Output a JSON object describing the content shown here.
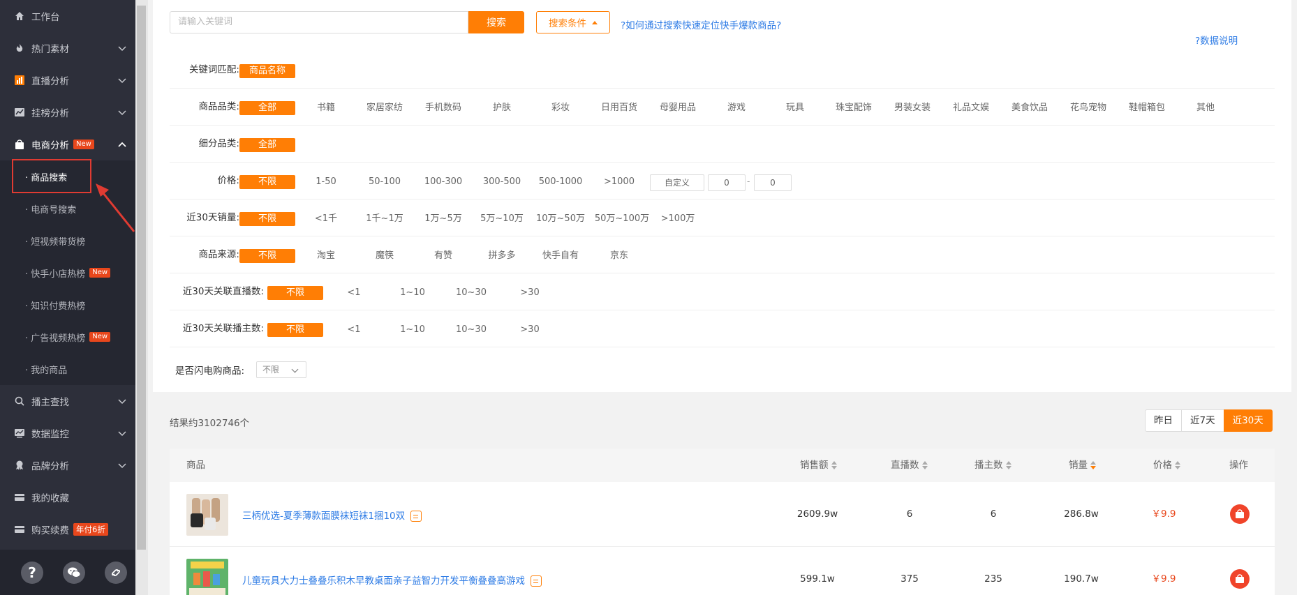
{
  "sidebar": {
    "items": [
      {
        "label": "工作台",
        "icon": "home-icon"
      },
      {
        "label": "热门素材",
        "icon": "flame-icon"
      },
      {
        "label": "直播分析",
        "icon": "bar-chart-icon"
      },
      {
        "label": "挂榜分析",
        "icon": "trend-icon"
      },
      {
        "label": "电商分析",
        "icon": "shopping-bag-icon",
        "badge": "New"
      }
    ],
    "sub_items": [
      {
        "label": "· 商品搜索"
      },
      {
        "label": "· 电商号搜索"
      },
      {
        "label": "· 短视频带货榜"
      },
      {
        "label": "· 快手小店热榜",
        "badge": "New"
      },
      {
        "label": "· 知识付费热榜"
      },
      {
        "label": "· 广告视频热榜",
        "badge": "New"
      },
      {
        "label": "· 我的商品"
      }
    ],
    "items_after": [
      {
        "label": "播主查找",
        "icon": "search-icon"
      },
      {
        "label": "数据监控",
        "icon": "monitor-icon"
      },
      {
        "label": "品牌分析",
        "icon": "award-icon"
      },
      {
        "label": "我的收藏",
        "icon": "card-icon"
      },
      {
        "label": "购买续费",
        "icon": "credit-card-icon",
        "badge": "年付6折"
      }
    ],
    "footer_help": "?"
  },
  "search": {
    "placeholder": "请输入关键词",
    "button": "搜索",
    "conditions": "搜索条件",
    "help_link": "?如何通过搜索快速定位快手爆款商品?",
    "data_note": "?数据说明"
  },
  "filters": {
    "keyword_match": {
      "label": "关键词匹配:",
      "options": [
        "商品名称"
      ]
    },
    "category": {
      "label": "商品品类:",
      "options": [
        "全部",
        "书籍",
        "家居家纺",
        "手机数码",
        "护肤",
        "彩妆",
        "日用百货",
        "母婴用品",
        "游戏",
        "玩具",
        "珠宝配饰",
        "男装女装",
        "礼品文娱",
        "美食饮品",
        "花鸟宠物",
        "鞋帽箱包",
        "其他"
      ]
    },
    "subcategory": {
      "label": "细分品类:",
      "options": [
        "全部"
      ]
    },
    "price": {
      "label": "价格:",
      "options": [
        "不限",
        "1-50",
        "50-100",
        "100-300",
        "300-500",
        "500-1000",
        ">1000"
      ],
      "custom": "自定义",
      "min": "0",
      "max": "0",
      "sep": "-"
    },
    "sales30": {
      "label": "近30天销量:",
      "options": [
        "不限",
        "<1千",
        "1千~1万",
        "1万~5万",
        "5万~10万",
        "10万~50万",
        "50万~100万",
        ">100万"
      ]
    },
    "source": {
      "label": "商品来源:",
      "options": [
        "不限",
        "淘宝",
        "魔筷",
        "有赞",
        "拼多多",
        "快手自有",
        "京东"
      ]
    },
    "live30": {
      "label": "近30天关联直播数:",
      "options": [
        "不限",
        "<1",
        "1~10",
        "10~30",
        ">30"
      ]
    },
    "anchor30": {
      "label": "近30天关联播主数:",
      "options": [
        "不限",
        "<1",
        "1~10",
        "10~30",
        ">30"
      ]
    },
    "flash": {
      "label": "是否闪电购商品:",
      "value": "不限"
    }
  },
  "results": {
    "count_text": "结果约3102746个",
    "periods": [
      "昨日",
      "近7天",
      "近30天"
    ],
    "active_period": 2
  },
  "table": {
    "headers": [
      "商品",
      "销售额",
      "直播数",
      "播主数",
      "销量",
      "价格",
      "操作"
    ],
    "rows": [
      {
        "name": "三柄优选-夏季薄款面膜袜短袜1捆10双",
        "sales_amount": "2609.9w",
        "lives": "6",
        "anchors": "6",
        "volume": "286.8w",
        "price": "￥9.9"
      },
      {
        "name": "儿童玩具大力士叠叠乐积木早教桌面亲子益智力开发平衡叠叠高游戏",
        "sales_amount": "599.1w",
        "lives": "375",
        "anchors": "235",
        "volume": "190.7w",
        "price": "￥9.9"
      }
    ]
  },
  "colors": {
    "accent": "#ff7e05",
    "link": "#2d7be5",
    "sidebar_bg": "#2d2f3a",
    "badge": "#e8471c",
    "price": "#e8471c"
  }
}
